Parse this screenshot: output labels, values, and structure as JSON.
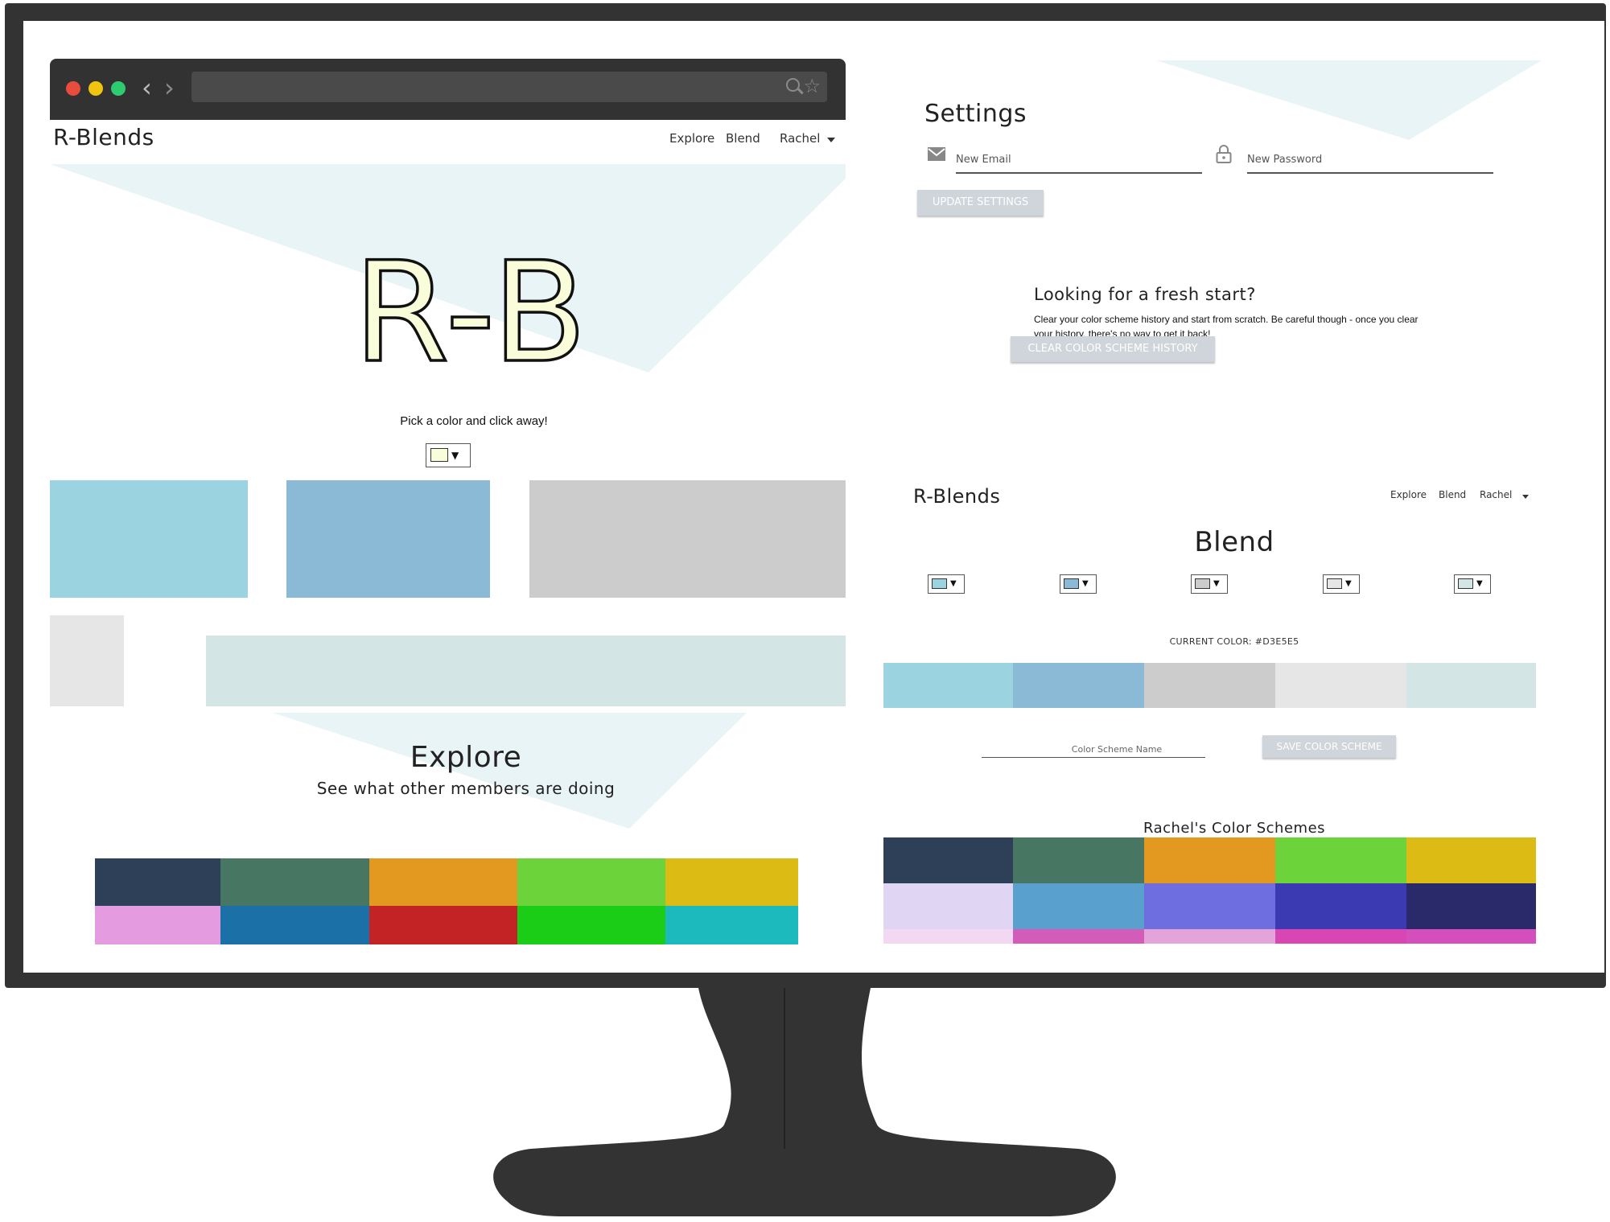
{
  "colors": {
    "frame": "#333333",
    "chrome": "#323232",
    "accent_triangle": "#e9f4f6",
    "button_bg": "#cfd5da",
    "dot_red": "#e84c3d",
    "dot_yellow": "#f1c40f",
    "dot_green": "#2ecc71"
  },
  "browser": {
    "back_icon": "chevron-left-icon",
    "forward_icon": "chevron-right-icon",
    "search_icon": "search-icon",
    "star_icon": "star-icon"
  },
  "home": {
    "logo": "R-Blends",
    "nav": {
      "explore": "Explore",
      "blend": "Blend",
      "user": "Rachel"
    },
    "hero_monogram": "R-B",
    "tagline": "Pick a color and click away!",
    "picker_color": "#fafdd9",
    "blocks": [
      "#9bd3e1",
      "#8bbad7",
      "#cccccc",
      "#e6e6e6",
      "#d3e5e5"
    ],
    "explore_title": "Explore",
    "explore_subtitle": "See what other members are doing",
    "explore_rows": [
      [
        "#2e4057",
        "#477762",
        "#e3981f",
        "#6dd33a",
        "#dcbb15"
      ],
      [
        "#e49be0",
        "#1c70a8",
        "#c42326",
        "#1ccd17",
        "#1cb9bd"
      ]
    ]
  },
  "settings": {
    "title": "Settings",
    "email_placeholder": "New Email",
    "password_placeholder": "New Password",
    "email_icon": "envelope-icon",
    "password_icon": "lock-icon",
    "update_button": "UPDATE SETTINGS",
    "fresh_title": "Looking for a fresh start?",
    "fresh_body": "Clear your color scheme history and start from scratch. Be careful though - once you clear your history, there's no way to get it back!",
    "clear_button": "CLEAR COLOR SCHEME HISTORY"
  },
  "blend": {
    "logo": "R-Blends",
    "nav": {
      "explore": "Explore",
      "blend": "Blend",
      "user": "Rachel"
    },
    "title": "Blend",
    "picker_colors": [
      "#9bd3e1",
      "#8bbad7",
      "#cccccc",
      "#e6e6e6",
      "#d3e5e5"
    ],
    "current_color_text": "CURRENT COLOR: #D3E5E5",
    "palette": [
      "#9bd3e1",
      "#8bbad7",
      "#cccccc",
      "#e6e6e6",
      "#d3e5e5"
    ],
    "scheme_name_placeholder": "Color Scheme Name",
    "save_button": "SAVE COLOR SCHEME",
    "schemes_title": "Rachel's Color Schemes",
    "scheme_rows": [
      [
        "#2e4057",
        "#477762",
        "#e3981f",
        "#6dd33a",
        "#dcbb15"
      ],
      [
        "#e0d6f3",
        "#5aa0cf",
        "#6f6ee1",
        "#3c3ab3",
        "#2a2a6a"
      ],
      [
        "#f3d8f3",
        "#d35cb9",
        "#e4a4d9",
        "#d846b3",
        "#d44fbd"
      ]
    ]
  }
}
